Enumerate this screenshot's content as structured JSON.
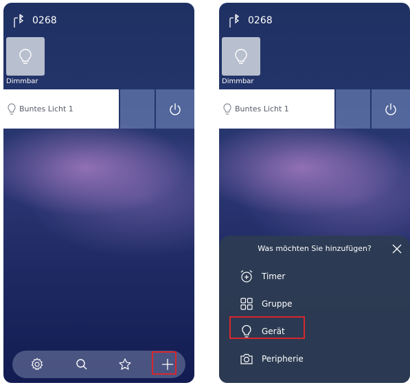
{
  "screens": [
    {
      "status_id": "0268",
      "tile_label": "Dimmbar",
      "device_name": "Buntes Licht 1",
      "nav_items": [
        "settings-icon",
        "search-icon",
        "star-icon",
        "add-icon"
      ]
    },
    {
      "status_id": "0268",
      "tile_label": "Dimmbar",
      "device_name": "Buntes Licht 1",
      "sheet": {
        "title": "Was möchten Sie hinzufügen?",
        "items": [
          {
            "label": "Timer",
            "icon": "alarm-add-icon"
          },
          {
            "label": "Gruppe",
            "icon": "grid-icon"
          },
          {
            "label": "Gerät",
            "icon": "bulb-icon"
          },
          {
            "label": "Peripherie",
            "icon": "camera-icon"
          }
        ]
      }
    }
  ],
  "colors": {
    "highlight": "#d9262c",
    "tile_bg": "#b8bfce",
    "sheet_bg": "#2d3c52"
  }
}
